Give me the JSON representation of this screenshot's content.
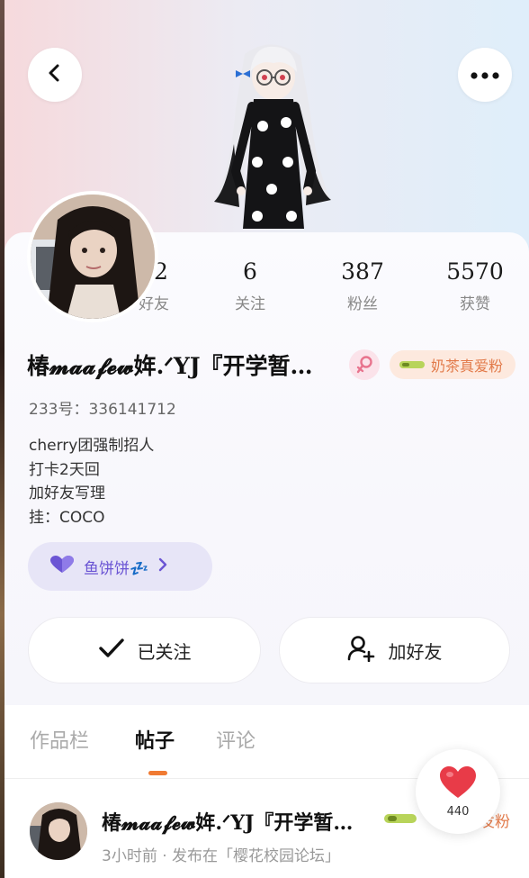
{
  "header": {
    "back_icon": "chevron-left-icon",
    "more_icon": "more-horizontal-icon"
  },
  "stats": [
    {
      "value": "42",
      "label": "好友"
    },
    {
      "value": "6",
      "label": "关注"
    },
    {
      "value": "387",
      "label": "粉丝"
    },
    {
      "value": "5570",
      "label": "获赞"
    }
  ],
  "profile": {
    "name": "椿𝓶𝓪𝓪𝓯𝓮𝔀姩.ᐟYJ『开学暂…",
    "gender_icon": "female-icon",
    "fan_badge": "奶茶真爱粉",
    "uid": "233号：336141712",
    "bio": [
      "cherry团强制招人",
      "打卡2天回",
      "加好友写理",
      "挂：COCO"
    ],
    "chip_label": "鱼饼饼💤",
    "chip_icon": "heart-icon"
  },
  "actions": {
    "followed": "已关注",
    "add_friend": "加好友"
  },
  "tabs": [
    {
      "label": "作品栏"
    },
    {
      "label": "帖子"
    },
    {
      "label": "评论"
    }
  ],
  "post": {
    "author": "椿𝓶𝓪𝓪𝓯𝓮𝔀姩.ᐟYJ『开学暂…",
    "badge_tail": "发粉",
    "meta": "3小时前 · 发布在「樱花校园论坛」"
  },
  "like": {
    "count": "440"
  },
  "colors": {
    "accent": "#f07a32",
    "chip_purple": "#6b55d4",
    "heart_red": "#e83b48",
    "badge_orange": "#e27a4a"
  }
}
